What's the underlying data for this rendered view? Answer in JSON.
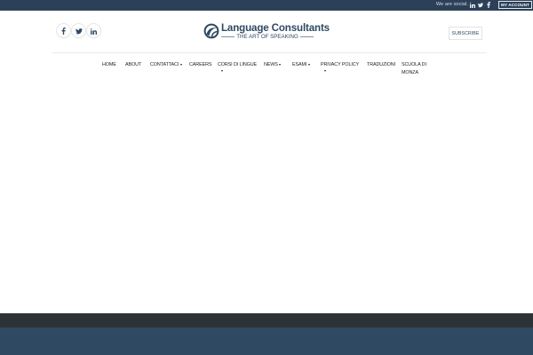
{
  "topbar": {
    "social_text": "We are social.",
    "social_icons": [
      "linkedin-icon",
      "twitter-icon",
      "facebook-icon"
    ],
    "account_label": "MY ACCOUNT",
    "bg_color": "#2c4159"
  },
  "header": {
    "social_icons": [
      "facebook-icon",
      "twitter-icon",
      "linkedin-icon"
    ],
    "logo": {
      "title": "Language Consultants",
      "tagline": "THE ART OF SPEAKING"
    },
    "subscribe_label": "SUBSCRIBE"
  },
  "nav": {
    "items": [
      {
        "label": "HOME",
        "dropdown": false
      },
      {
        "label": "ABOUT",
        "dropdown": false
      },
      {
        "label": "CONTATTACI",
        "dropdown": true
      },
      {
        "label": "CAREERS",
        "dropdown": false
      },
      {
        "label": "CORSI DI LINGUE",
        "dropdown": true
      },
      {
        "label": "NEWS",
        "dropdown": true
      },
      {
        "label": "ESAMI",
        "dropdown": true
      },
      {
        "label": "PRIVACY POLICY",
        "dropdown": true
      },
      {
        "label": "TRADUZIONI",
        "dropdown": false
      },
      {
        "label": "SCUOLA DI",
        "label2": "MONZA",
        "dropdown": false
      }
    ]
  },
  "footer": {
    "dark_color": "#2d3236",
    "blue_color": "#2f4962"
  }
}
